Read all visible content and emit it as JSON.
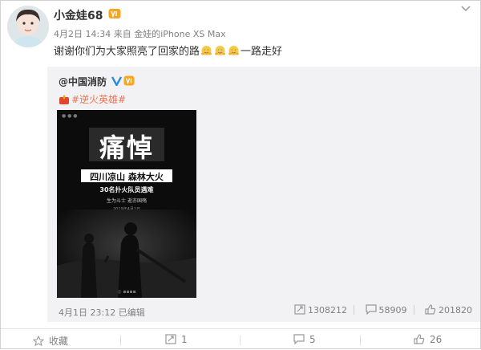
{
  "post": {
    "username": "小金娃68",
    "date": "4月2日 14:34",
    "from_prefix": "来自",
    "source": "金娃的iPhone XS Max",
    "text": "谢谢你们为大家照亮了回家的路",
    "text_tail": "一路走好"
  },
  "repost": {
    "author": "@中国消防",
    "topic": "#逆火英雄#",
    "poster": {
      "headline": "痛悼",
      "band": "四川凉山 森林大火",
      "line2": "30名扑火队员遇难",
      "line3": "生为斗士 逝亦国殇",
      "line4": "2019年4月1日"
    },
    "meta": {
      "date": "4月1日 23:12",
      "edited": "已编辑"
    },
    "stats": {
      "reposts": "1308212",
      "comments": "58909",
      "likes": "201820"
    }
  },
  "actions": {
    "favorite": "收藏",
    "repost": "1",
    "comment": "5",
    "like": "26"
  },
  "colors": {
    "accent_orange": "#eb7350",
    "meta_gray": "#808080",
    "repost_bg": "#f2f2f5"
  }
}
